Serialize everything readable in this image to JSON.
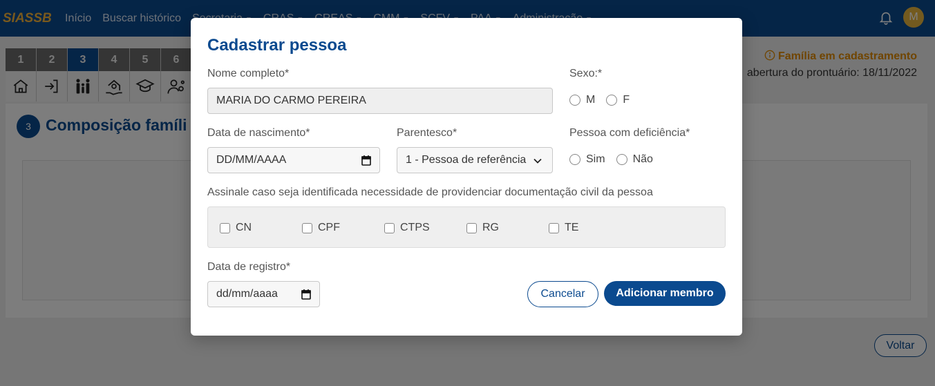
{
  "navbar": {
    "brand": "SIASSB",
    "links": [
      {
        "label": "Início",
        "dropdown": false
      },
      {
        "label": "Buscar histórico",
        "dropdown": false
      },
      {
        "label": "Secretaria",
        "dropdown": true
      },
      {
        "label": "CRAS",
        "dropdown": true
      },
      {
        "label": "CREAS",
        "dropdown": true
      },
      {
        "label": "CMM",
        "dropdown": true
      },
      {
        "label": "SCFV",
        "dropdown": true
      },
      {
        "label": "PAA",
        "dropdown": true
      },
      {
        "label": "Administração",
        "dropdown": true
      }
    ],
    "avatar_initial": "M"
  },
  "background": {
    "steps": [
      {
        "num": "1",
        "icon": "home-icon",
        "active": false
      },
      {
        "num": "2",
        "icon": "login-icon",
        "active": false
      },
      {
        "num": "3",
        "icon": "family-icon",
        "active": true
      },
      {
        "num": "4",
        "icon": "house-money-icon",
        "active": false
      },
      {
        "num": "5",
        "icon": "graduation-icon",
        "active": false
      },
      {
        "num": "6",
        "icon": "worker-gear-icon",
        "active": false
      }
    ],
    "status": "Família em cadastramento",
    "date_text": "abertura do prontuário: 18/11/2022",
    "section_number": "3",
    "section_title": "Composição famíli",
    "back_button": "Voltar"
  },
  "modal": {
    "title": "Cadastrar pessoa",
    "nome_label": "Nome completo*",
    "nome_value": "MARIA DO CARMO PEREIRA",
    "sexo_label": "Sexo:*",
    "sexo_options": [
      "M",
      "F"
    ],
    "nascimento_label": "Data de nascimento*",
    "nascimento_value": "DD/MM/AAAA",
    "parentesco_label": "Parentesco*",
    "parentesco_value": "1 - Pessoa de referência",
    "deficiencia_label": "Pessoa com deficiência*",
    "deficiencia_options": [
      "Sim",
      "Não"
    ],
    "doc_label": "Assinale caso seja identificada necessidade de providenciar documentação civil da pessoa",
    "doc_options": [
      "CN",
      "CPF",
      "CTPS",
      "RG",
      "TE"
    ],
    "registro_label": "Data de registro*",
    "registro_value": "dd/mm/aaaa",
    "cancel_label": "Cancelar",
    "add_label": "Adicionar membro"
  },
  "colors": {
    "primary": "#0b4a8f",
    "brand": "#f3b23b",
    "warning": "#e08a00"
  }
}
